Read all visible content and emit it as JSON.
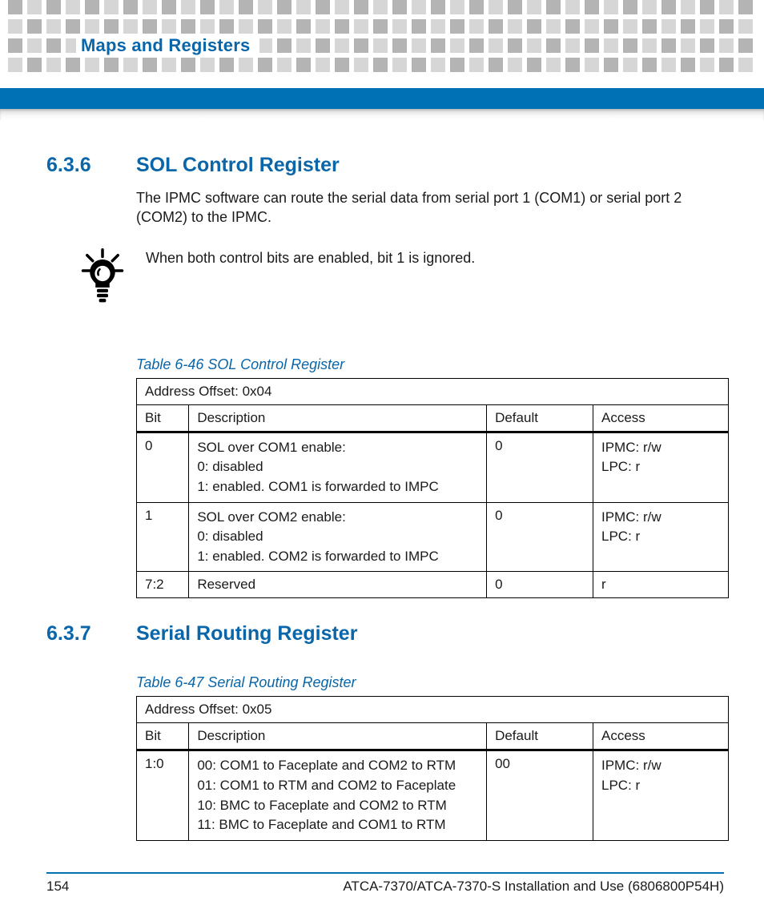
{
  "chapter": "Maps and Registers",
  "footer": {
    "page": "154",
    "doc": "ATCA-7370/ATCA-7370-S Installation and Use (6806800P54H)"
  },
  "sec636": {
    "num": "6.3.6",
    "title": "SOL Control Register",
    "para": "The IPMC software can route the serial data from serial port 1 (COM1) or serial port 2 (COM2) to the IPMC.",
    "tip": "When both control bits are enabled, bit 1 is ignored."
  },
  "table646": {
    "caption": "Table 6-46 SOL Control Register",
    "addr": "Address Offset: 0x04",
    "cols": {
      "bit": "Bit",
      "desc": "Description",
      "def": "Default",
      "acc": "Access"
    },
    "rows": [
      {
        "bit": "0",
        "desc": "SOL over COM1 enable:\n0: disabled\n1: enabled. COM1 is forwarded to IMPC",
        "def": "0",
        "acc": "IPMC: r/w\nLPC: r"
      },
      {
        "bit": "1",
        "desc": "SOL over COM2 enable:\n0: disabled\n1: enabled. COM2 is forwarded to IMPC",
        "def": "0",
        "acc": "IPMC: r/w\nLPC: r"
      },
      {
        "bit": "7:2",
        "desc": "Reserved",
        "def": "0",
        "acc": "r"
      }
    ]
  },
  "sec637": {
    "num": "6.3.7",
    "title": "Serial Routing Register"
  },
  "table647": {
    "caption": "Table 6-47 Serial Routing Register",
    "addr": "Address Offset: 0x05",
    "cols": {
      "bit": "Bit",
      "desc": "Description",
      "def": "Default",
      "acc": "Access"
    },
    "rows": [
      {
        "bit": "1:0",
        "desc": "00: COM1 to Faceplate and COM2 to RTM\n01: COM1 to RTM and COM2 to Faceplate\n10: BMC to Faceplate and COM2 to RTM\n11: BMC to Faceplate and COM1 to RTM",
        "def": "00",
        "acc": "IPMC: r/w\nLPC: r"
      }
    ]
  }
}
